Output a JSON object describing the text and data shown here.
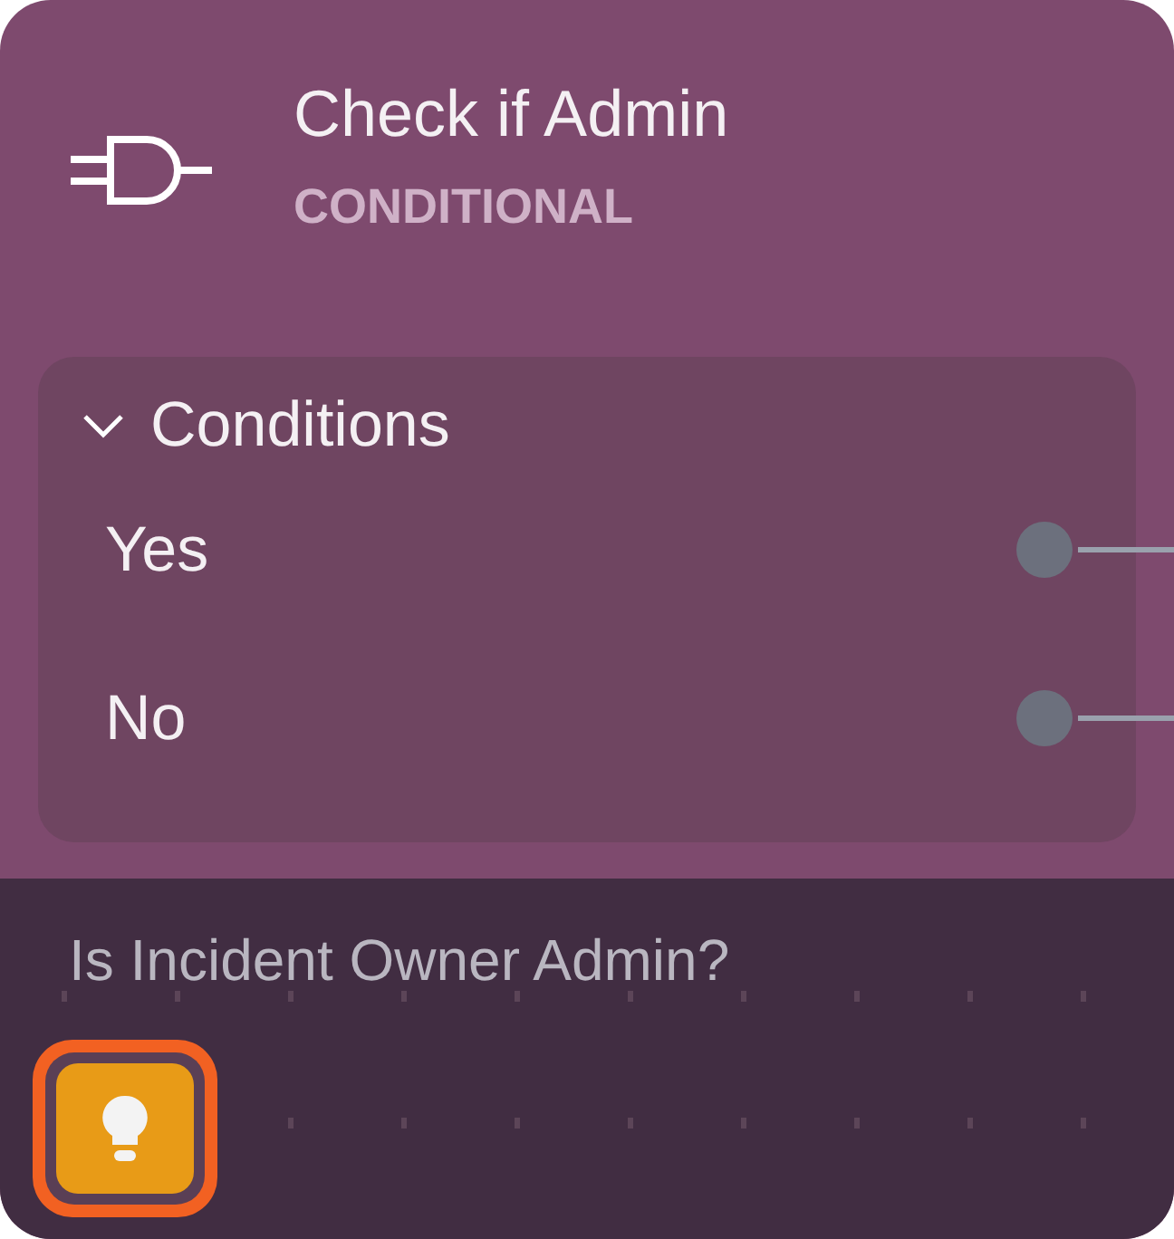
{
  "node": {
    "title": "Check if Admin",
    "type_label": "CONDITIONAL"
  },
  "section": {
    "label": "Conditions",
    "expanded": true
  },
  "conditions": [
    {
      "label": "Yes",
      "connected": true
    },
    {
      "label": "No",
      "connected": true
    }
  ],
  "description": "Is Incident Owner Admin?",
  "hint_button": {
    "selected": true
  }
}
